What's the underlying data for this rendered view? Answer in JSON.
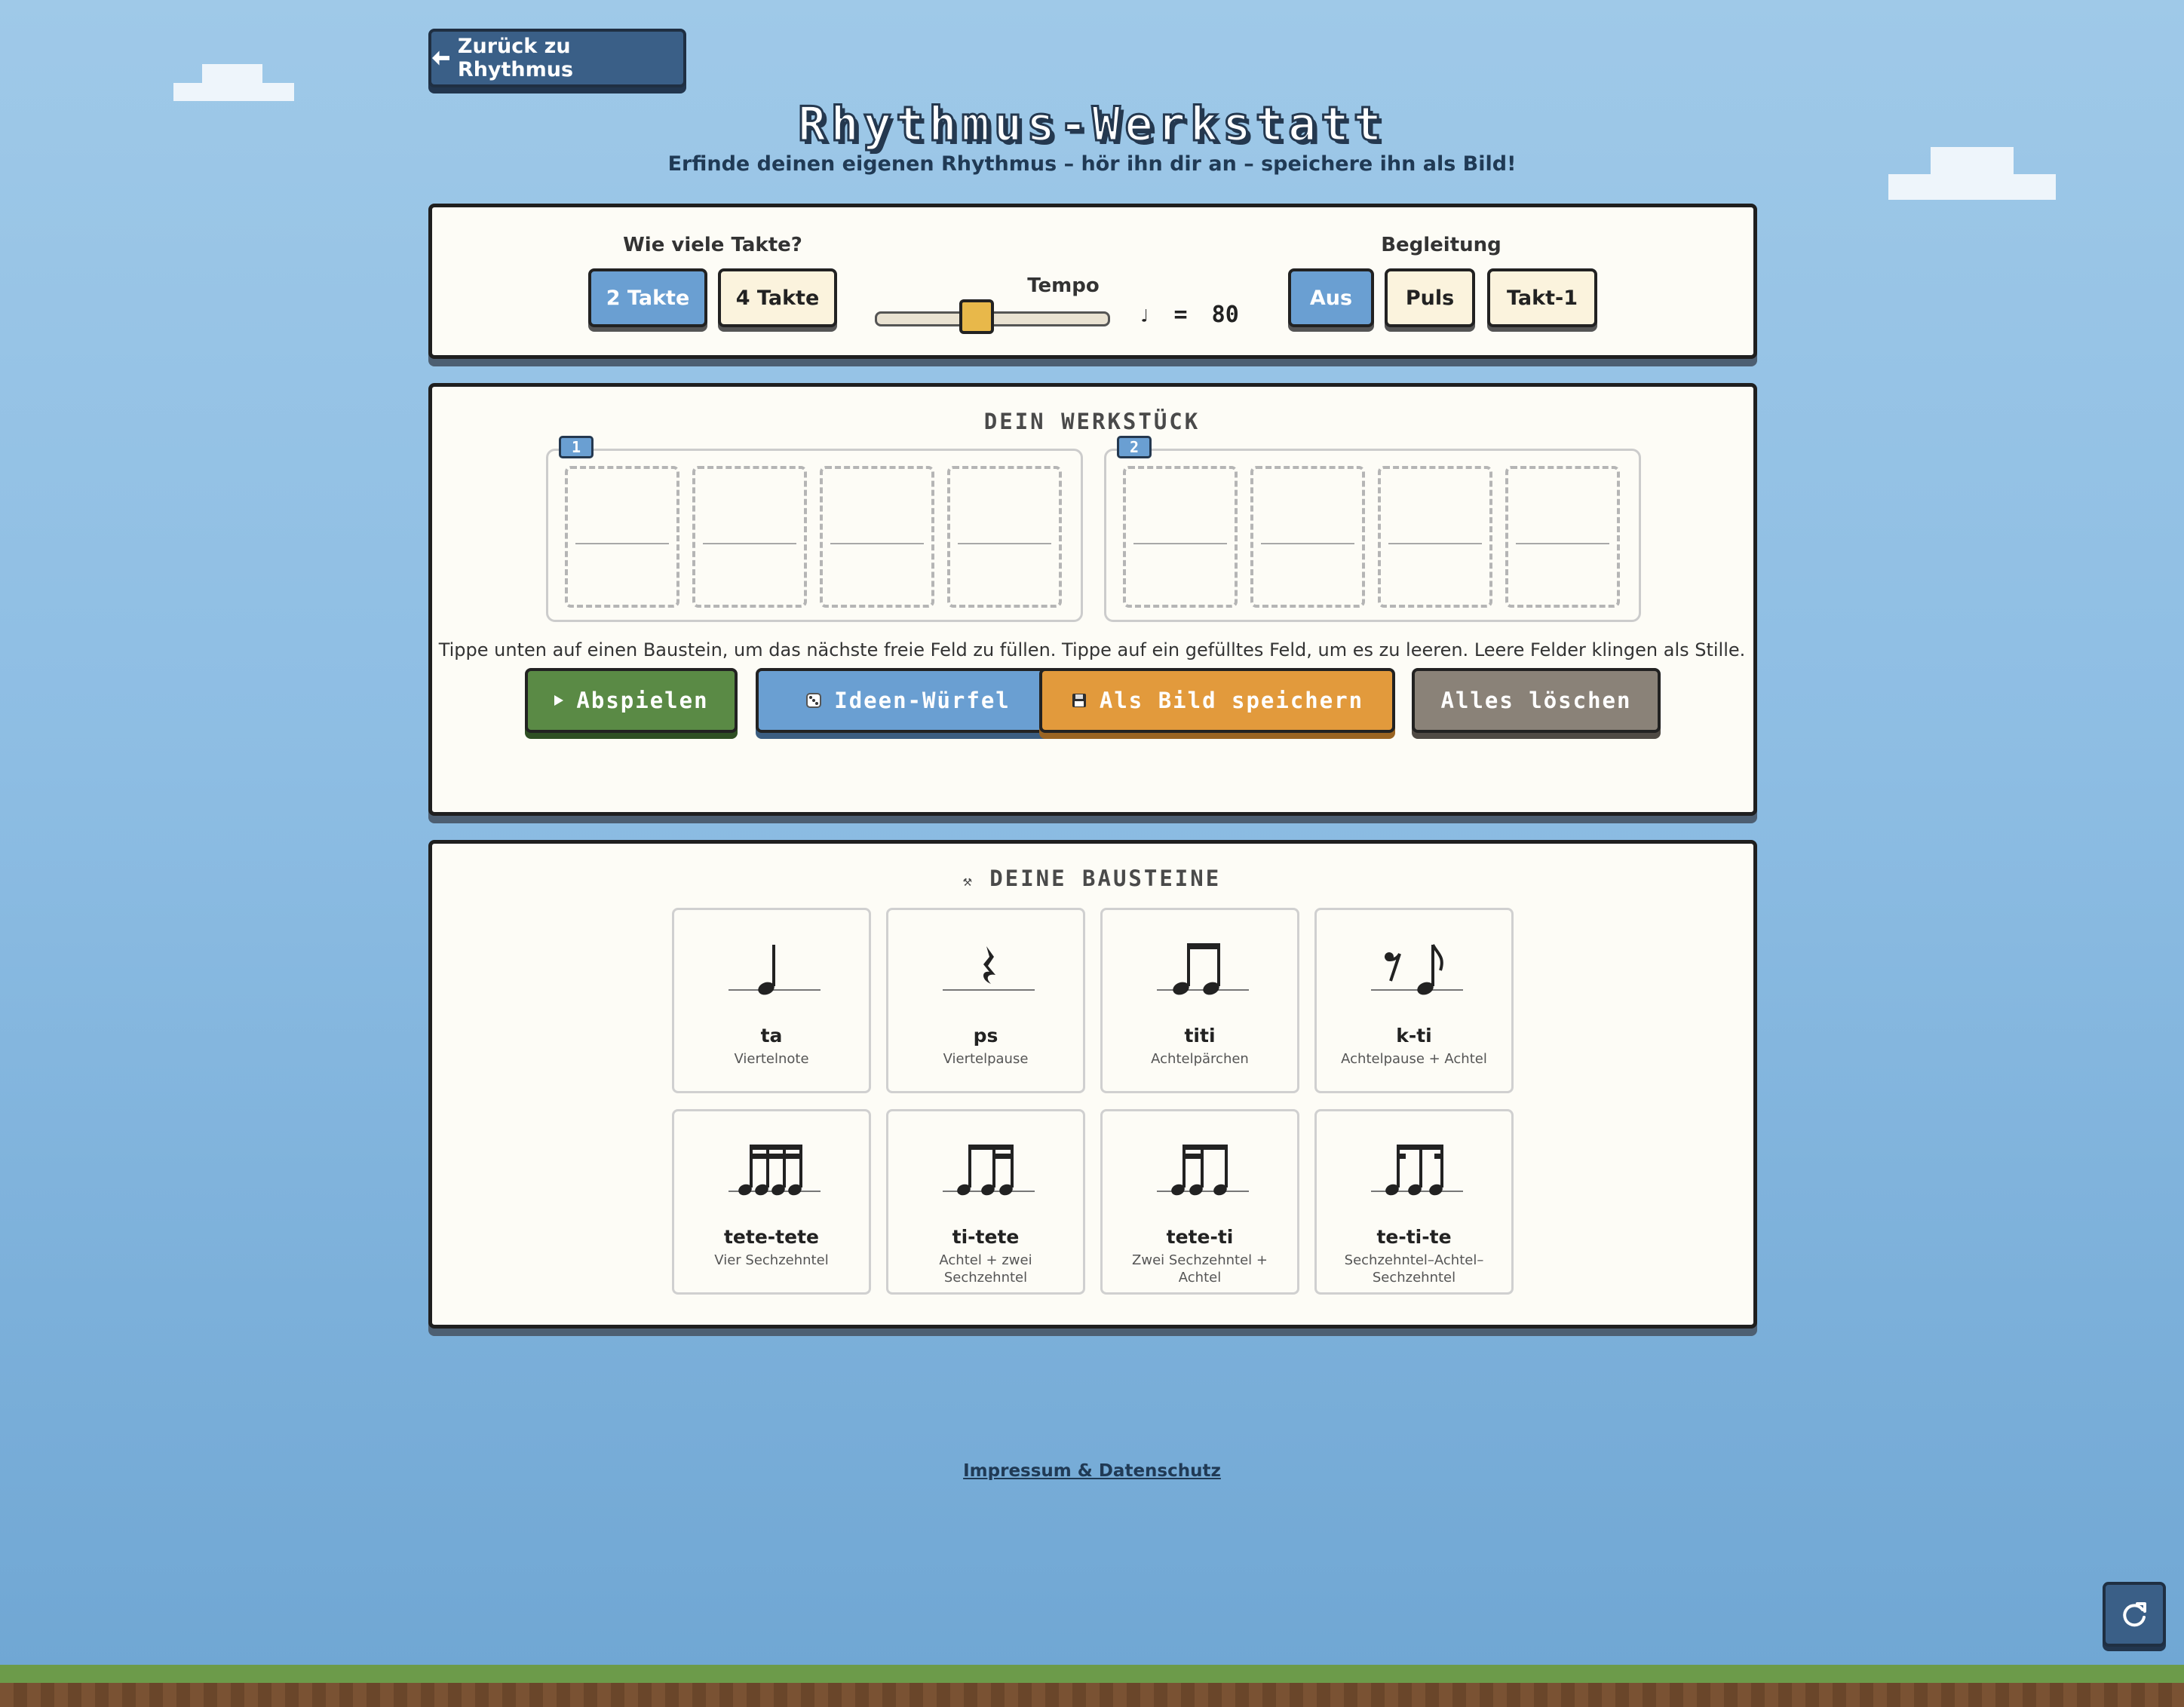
{
  "nav": {
    "back_label": "Zurück zu Rhythmus"
  },
  "header": {
    "title": "Rhythmus-Werkstatt",
    "subtitle": "Erfinde deinen eigenen Rhythmus – hör ihn dir an – speichere ihn als Bild!"
  },
  "settings": {
    "takte_label": "Wie viele Takte?",
    "takte_options": [
      "2 Takte",
      "4 Takte"
    ],
    "takte_selected": "2 Takte",
    "tempo_label": "Tempo",
    "tempo_note": "♩",
    "tempo_equals": "=",
    "tempo_value": "80",
    "tempo_slider_fraction": 0.45,
    "begleitung_label": "Begleitung",
    "begleitung_options": [
      "Aus",
      "Puls",
      "Takt-1"
    ],
    "begleitung_selected": "Aus"
  },
  "werkstueck": {
    "title": "DEIN WERKSTÜCK",
    "measures": [
      {
        "number": "1",
        "slots": 4
      },
      {
        "number": "2",
        "slots": 4
      }
    ],
    "hint": "Tippe unten auf einen Baustein, um das nächste freie Feld zu füllen. Tippe auf ein gefülltes Feld, um es zu leeren. Leere Felder klingen als Stille.",
    "actions": {
      "play": "Abspielen",
      "dice": "Ideen-Würfel",
      "save": "Als Bild speichern",
      "clear": "Alles löschen"
    }
  },
  "bausteine": {
    "title": "DEINE BAUSTEINE",
    "items": [
      {
        "name": "ta",
        "desc": "Viertelnote",
        "icon": "quarter-note-icon"
      },
      {
        "name": "ps",
        "desc": "Viertelpause",
        "icon": "quarter-rest-icon"
      },
      {
        "name": "titi",
        "desc": "Achtelpärchen",
        "icon": "eighth-pair-icon"
      },
      {
        "name": "k-ti",
        "desc": "Achtelpause + Achtel",
        "icon": "eighth-rest-eighth-icon"
      },
      {
        "name": "tete-tete",
        "desc": "Vier Sechzehntel",
        "icon": "four-sixteenths-icon"
      },
      {
        "name": "ti-tete",
        "desc": "Achtel + zwei Sechzehntel",
        "icon": "eighth-two-sixteenths-icon"
      },
      {
        "name": "tete-ti",
        "desc": "Zwei Sechzehntel + Achtel",
        "icon": "two-sixteenths-eighth-icon"
      },
      {
        "name": "te-ti-te",
        "desc": "Sechzehntel–Achtel–Sechzehntel",
        "icon": "sixteenth-eighth-sixteenth-icon"
      }
    ]
  },
  "footer": {
    "link": "Impressum & Datenschutz"
  },
  "colors": {
    "accent_blue": "#6a9fd2",
    "play_green": "#5a8a45",
    "save_orange": "#e29a3c",
    "clear_gray": "#8a8278"
  }
}
